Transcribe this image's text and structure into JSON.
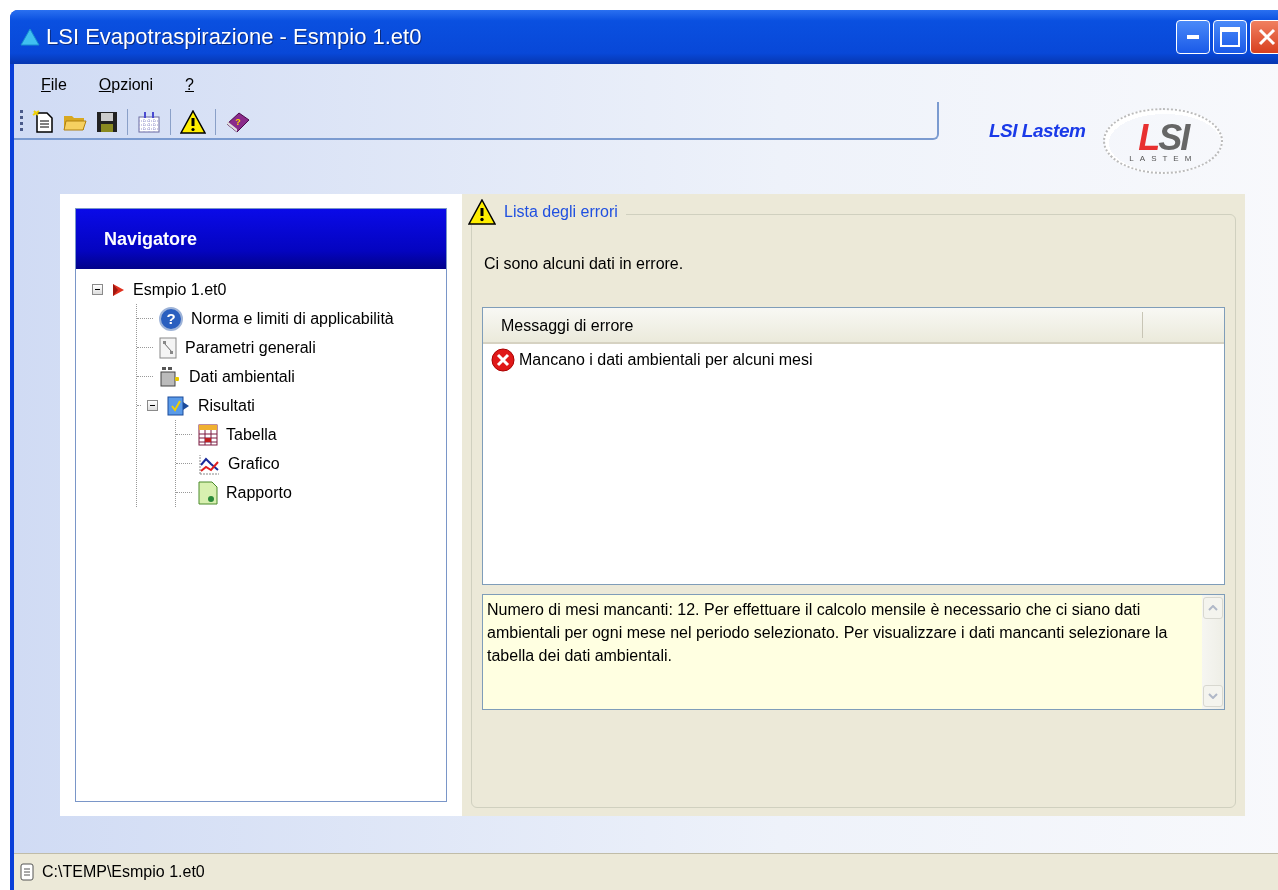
{
  "window": {
    "title": "LSI Evapotraspirazione - Esmpio 1.et0"
  },
  "menu": [
    {
      "label": "File"
    },
    {
      "label": "Opzioni"
    },
    {
      "label": "?"
    }
  ],
  "brand": {
    "name": "LSI Lastem",
    "logo_mark": "LSI",
    "logo_subtitle": "LASTEM"
  },
  "navigator": {
    "title": "Navigatore",
    "tree": [
      {
        "label": "Esmpio 1.et0",
        "kind": "file",
        "expanded": true,
        "children": [
          {
            "label": "Norma e limiti di applicabilità",
            "kind": "help"
          },
          {
            "label": "Parametri generali",
            "kind": "params"
          },
          {
            "label": "Dati ambientali",
            "kind": "data"
          },
          {
            "label": "Risultati",
            "kind": "results",
            "expanded": true,
            "children": [
              {
                "label": "Tabella",
                "kind": "table"
              },
              {
                "label": "Grafico",
                "kind": "chart"
              },
              {
                "label": "Rapporto",
                "kind": "report"
              }
            ]
          }
        ]
      }
    ]
  },
  "errors": {
    "title": "Lista degli errori",
    "summary": "Ci sono alcuni dati in errore.",
    "columns": [
      "Messaggi di errore"
    ],
    "rows": [
      {
        "text": "Mancano i dati ambientali per alcuni mesi",
        "kind": "error"
      }
    ],
    "details": "Numero di mesi mancanti: 12. Per effettuare il calcolo mensile è necessario che ci siano dati ambientali per ogni mese nel periodo selezionato. Per visualizzare i dati mancanti selezionare la tabella dei dati ambientali."
  },
  "status_bar": {
    "text": "C:\\TEMP\\Esmpio 1.et0"
  }
}
